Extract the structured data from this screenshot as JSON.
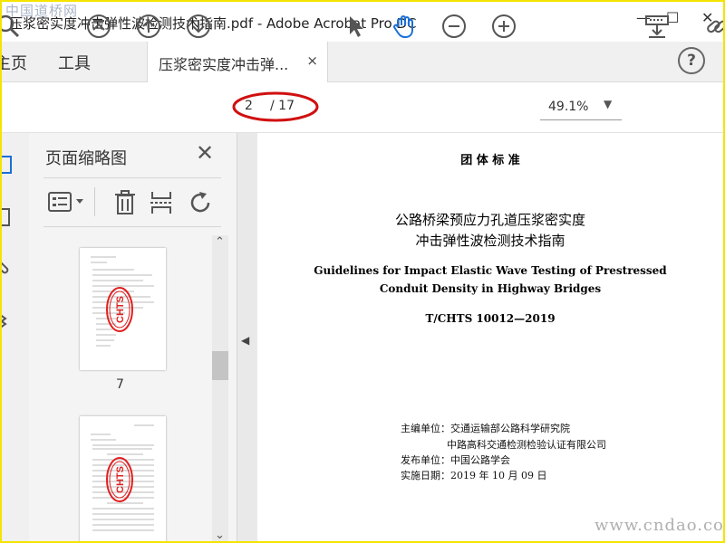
{
  "window": {
    "title": "压浆密实度冲击弹性波检测技术指南.pdf - Adobe Acrobat Pro DC",
    "watermark": "中国道桥网",
    "controls": [
      "—",
      "☐",
      "✕"
    ]
  },
  "menu": {
    "home": "主页",
    "tools": "工具"
  },
  "tab": {
    "label": "压浆密实度冲击弹...",
    "close": "×"
  },
  "help": "?",
  "toolbar": {
    "page_current": "2",
    "page_total": "/ 17",
    "zoom": "49.1%"
  },
  "panel": {
    "title": "页面缩略图",
    "close": "✕",
    "thumbnails": [
      {
        "label": "7",
        "stamp": "CHTS"
      },
      {
        "label": "",
        "stamp": "CHTS"
      }
    ]
  },
  "document": {
    "type": "团 体 标 准",
    "title_cn_1": "公路桥梁预应力孔道压浆密实度",
    "title_cn_2": "冲击弹性波检测技术指南",
    "title_en_1": "Guidelines for Impact Elastic Wave Testing of Prestressed",
    "title_en_2": "Conduit Density in Highway Bridges",
    "code": "T/CHTS  10012—2019",
    "editor_line1": "主编单位：交通运输部公路科学研究院",
    "editor_line2": "中路高科交通检测检验认证有限公司",
    "publisher": "发布单位：中国公路学会",
    "date": "实施日期：2019 年 10 月 09 日"
  },
  "site_watermark": "www.cndao.com",
  "colors": {
    "frame": "#f5e400",
    "highlight_ellipse": "#d01010",
    "hand_tool": "#1a6fd6"
  }
}
